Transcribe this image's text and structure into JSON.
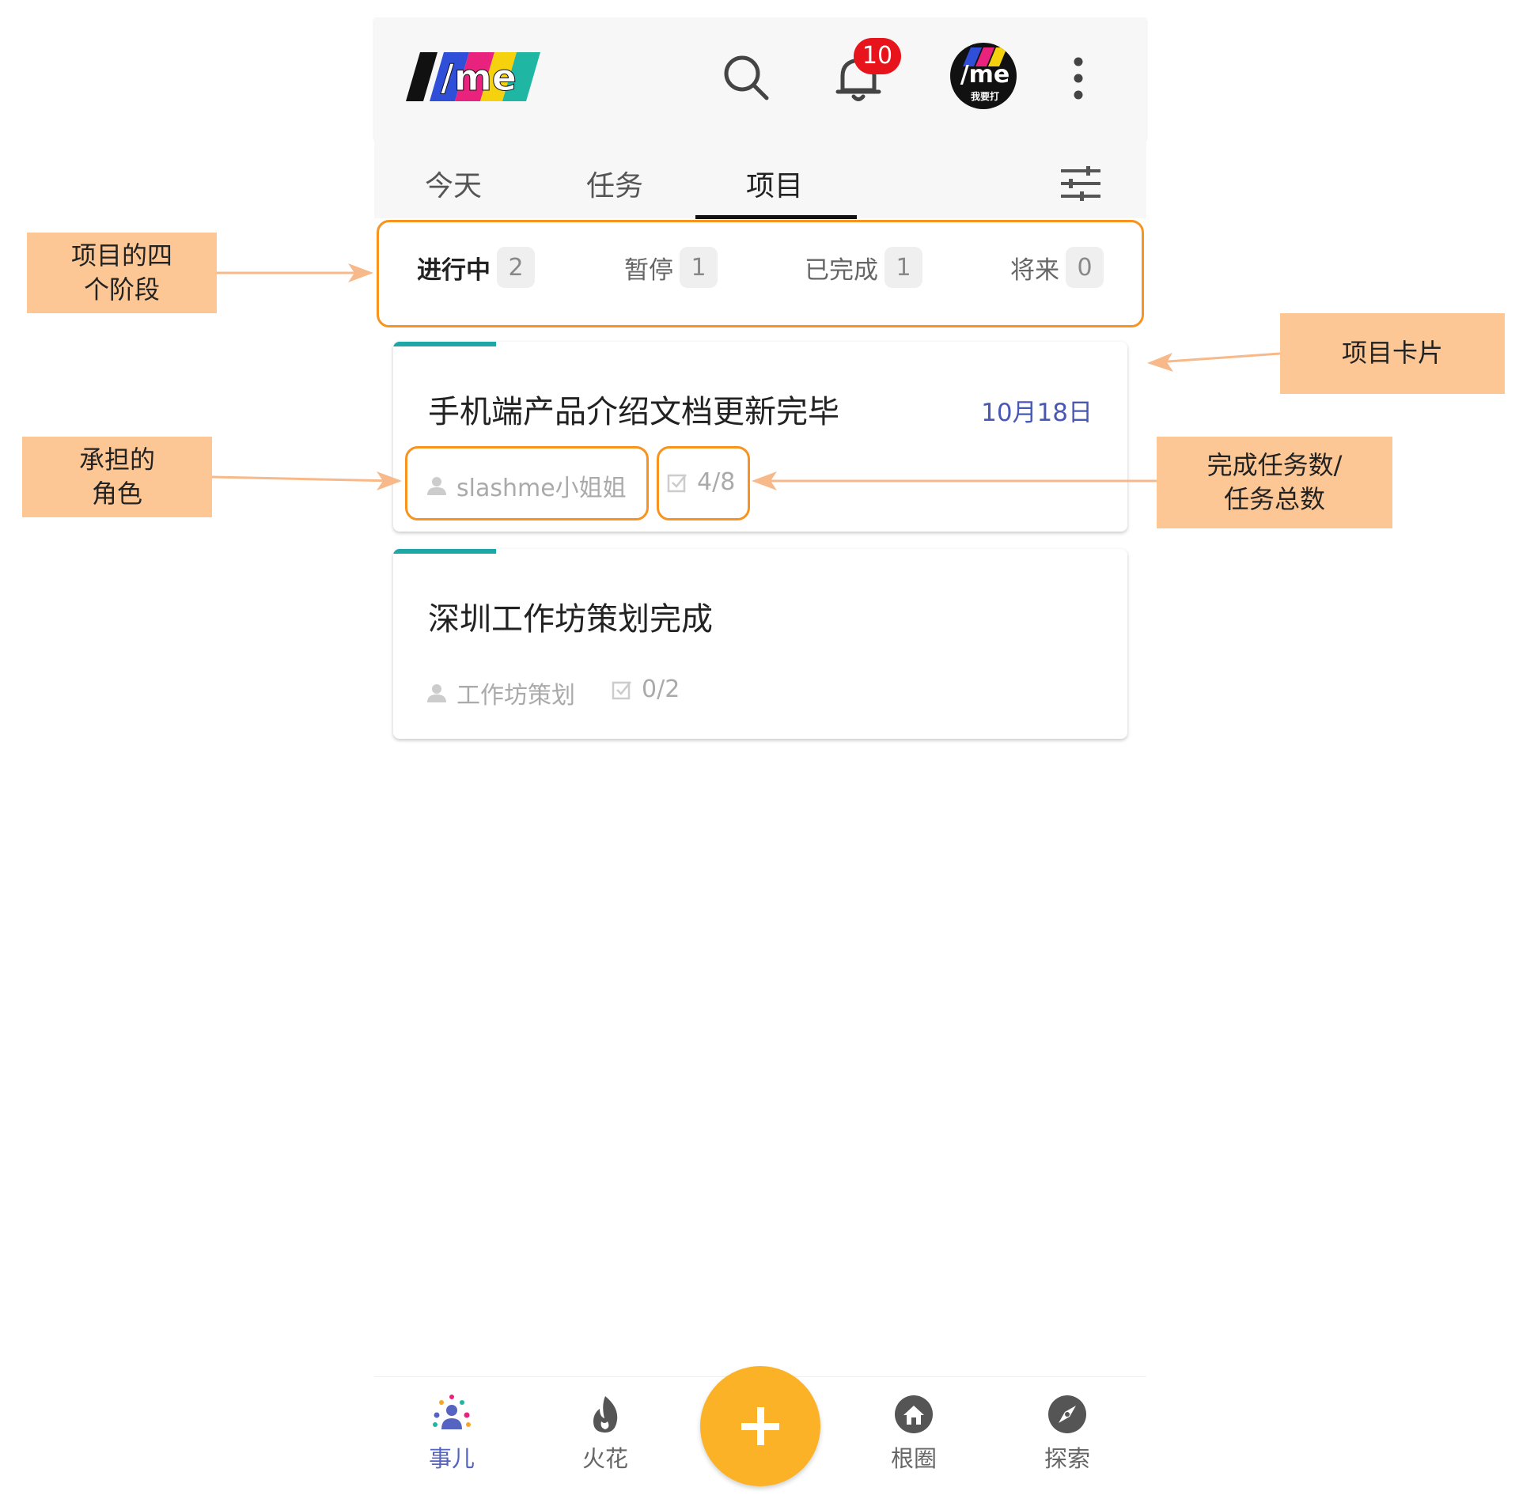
{
  "header": {
    "logo": "/me",
    "notification_count": "10",
    "avatar_text": "/me",
    "avatar_sub": "我要打",
    "icons": [
      "search-icon",
      "bell-icon",
      "more-vert-icon"
    ]
  },
  "tabs": [
    {
      "label": "今天",
      "active": false
    },
    {
      "label": "任务",
      "active": false
    },
    {
      "label": "项目",
      "active": true
    }
  ],
  "stages": [
    {
      "label": "进行中",
      "count": "2",
      "active": true
    },
    {
      "label": "暂停",
      "count": "1",
      "active": false
    },
    {
      "label": "已完成",
      "count": "1",
      "active": false
    },
    {
      "label": "将来",
      "count": "0",
      "active": false
    }
  ],
  "projects": [
    {
      "title": "手机端产品介绍文档更新完毕",
      "date": "10月18日",
      "role": "slashme小姐姐",
      "progress": "4/8"
    },
    {
      "title": "深圳工作坊策划完成",
      "date": "",
      "role": "工作坊策划",
      "progress": "0/2"
    }
  ],
  "bottom_nav": [
    {
      "label": "事儿",
      "icon": "people-icon",
      "active": true
    },
    {
      "label": "火花",
      "icon": "flame-icon",
      "active": false
    },
    {
      "label": "根圈",
      "icon": "home-icon",
      "active": false
    },
    {
      "label": "探索",
      "icon": "compass-icon",
      "active": false
    }
  ],
  "fab": {
    "icon": "plus-icon"
  },
  "annotations": {
    "stages_note": "项目的四\n个阶段",
    "card_note": "项目卡片",
    "role_note": "承担的\n角色",
    "progress_note": "完成任务数/\n任务总数"
  },
  "colors": {
    "accent_blue": "#5563c1",
    "teal": "#1fa6a6",
    "fab": "#fbb227",
    "badge": "#e8141b",
    "highlight": "#f7931e",
    "note_bg": "#fcc795"
  }
}
